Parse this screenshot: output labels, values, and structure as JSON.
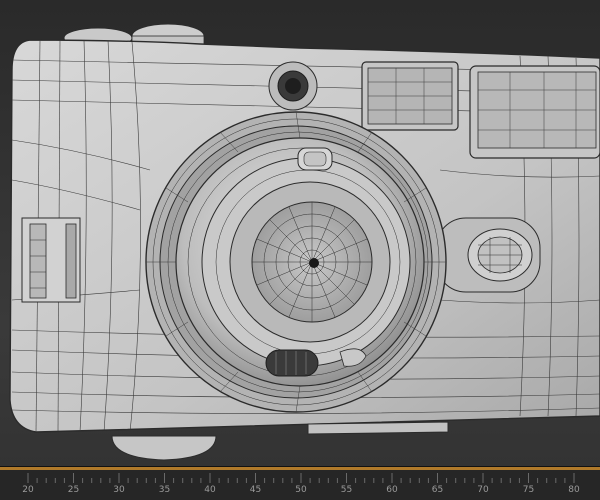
{
  "viewport": {
    "subject": "camera-wireframe-model",
    "colors": {
      "background_top": "#2a2a2a",
      "background_bottom": "#3a3a3a",
      "mesh_fill": "#cfcfcf",
      "mesh_shadow": "#9e9e9e",
      "wire": "#2b2b2b"
    }
  },
  "timeline": {
    "accent_color": "#b07a2a",
    "ticks": [
      "20",
      "25",
      "30",
      "35",
      "40",
      "45",
      "50",
      "55",
      "60",
      "65",
      "70",
      "75",
      "80"
    ]
  }
}
